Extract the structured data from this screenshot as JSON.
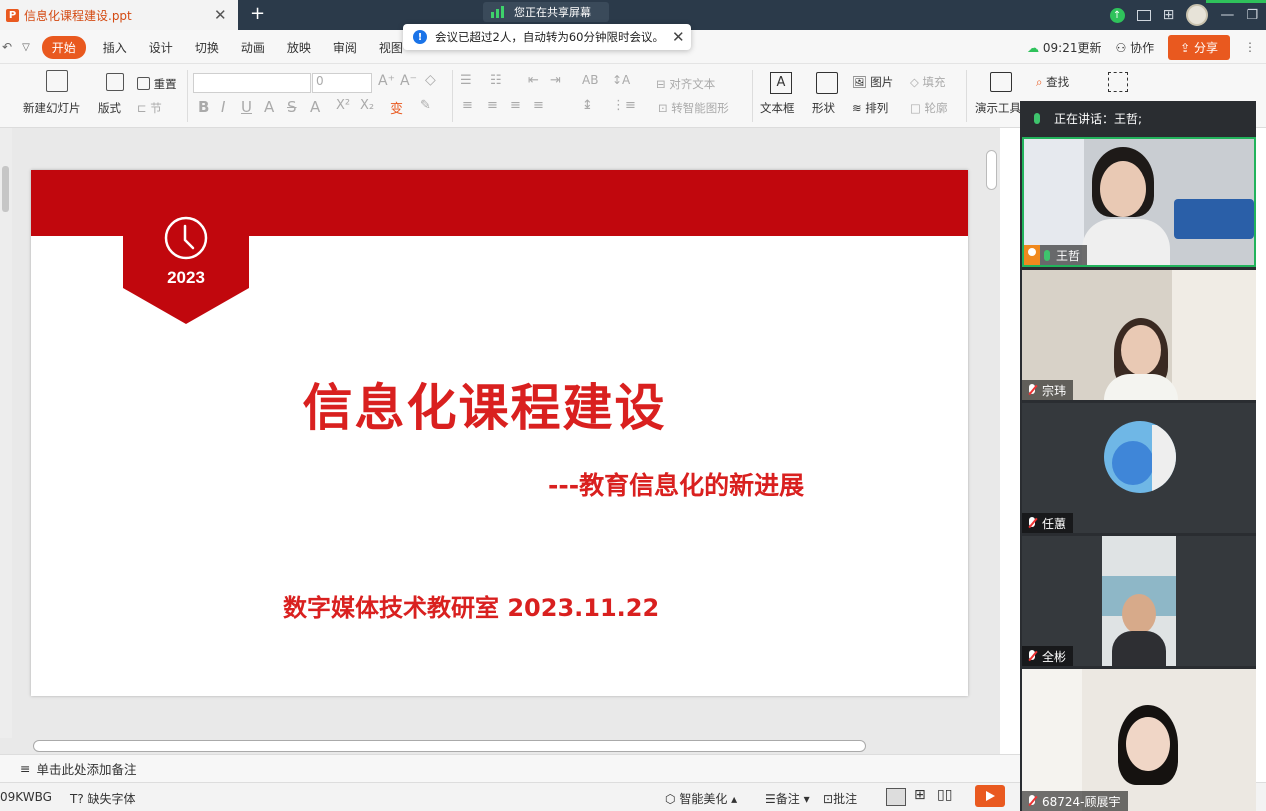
{
  "titlebar": {
    "tab_title": "信息化课程建设.ppt",
    "share_status": "您正在共享屏幕"
  },
  "notice": {
    "text": "会议已超过2人，自动转为60分钟限时会议。"
  },
  "menubar": {
    "items": [
      "开始",
      "插入",
      "设计",
      "切换",
      "动画",
      "放映",
      "审阅",
      "视图"
    ],
    "update_label": "09:21更新",
    "collab_label": "协作",
    "share_label": "分享"
  },
  "ribbon": {
    "new_slide": "新建幻灯片",
    "layout": "版式",
    "reset": "重置",
    "section": "节",
    "font_size_value": "0",
    "align_text": "对齐文本",
    "smart_shape": "转智能图形",
    "textbox": "文本框",
    "shape": "形状",
    "picture": "图片",
    "arrange": "排列",
    "fill": "填充",
    "outline": "轮廓",
    "presenter_tools": "演示工具",
    "find": "查找"
  },
  "slide": {
    "year": "2023",
    "title": "信息化课程建设",
    "subtitle": "---教育信息化的新进展",
    "footer": "数字媒体技术教研室 2023.11.22",
    "band_color": "#c1070d",
    "text_color": "#d9201f"
  },
  "notes": {
    "placeholder": "单击此处添加备注"
  },
  "statusbar": {
    "left_code": "09KWBG",
    "missing_font": "缺失字体",
    "smart_beautify": "智能美化",
    "notes_label": "备注",
    "comments_label": "批注"
  },
  "meeting": {
    "speaking_prefix": "正在讲话：",
    "speaking_name": "王哲;",
    "participants": [
      {
        "name": "王哲",
        "muted": false,
        "host": true
      },
      {
        "name": "宗玮",
        "muted": true,
        "host": false
      },
      {
        "name": "任蕙",
        "muted": true,
        "host": false
      },
      {
        "name": "全彬",
        "muted": true,
        "host": false
      },
      {
        "name": "68724-顾展宇",
        "muted": true,
        "host": false
      }
    ]
  }
}
